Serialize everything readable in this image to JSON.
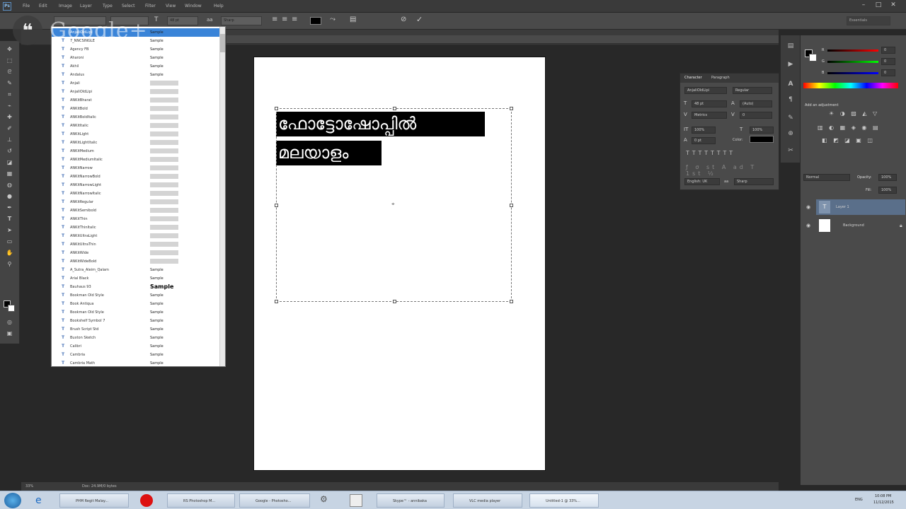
{
  "app": {
    "name": "Ps",
    "menu": [
      "File",
      "Edit",
      "Image",
      "Layer",
      "Type",
      "Select",
      "Filter",
      "View",
      "Window",
      "Help"
    ]
  },
  "options": {
    "font_size": "48 pt",
    "antialias": "Sharp",
    "workspace": "Essentials"
  },
  "font_list": [
    {
      "name": "AnjaliOldLipi",
      "sample": "Sample",
      "selected": true
    },
    {
      "name": "7_NNCSINGLE",
      "sample": "Sample"
    },
    {
      "name": "Agency FB",
      "sample": "Sample"
    },
    {
      "name": "Aharoni",
      "sample": "Sample"
    },
    {
      "name": "Akhil",
      "sample": "Sample"
    },
    {
      "name": "Andalus",
      "sample": "Sample"
    },
    {
      "name": "Anjali",
      "sample": "[boxed]"
    },
    {
      "name": "AnjaliOldLipi",
      "sample": "[boxed]"
    },
    {
      "name": "ANKitBharat",
      "sample": "[boxed]"
    },
    {
      "name": "ANKitBold",
      "sample": "[boxed]"
    },
    {
      "name": "ANKitBoldItalic",
      "sample": "[boxed]"
    },
    {
      "name": "ANKitItalic",
      "sample": "[boxed]"
    },
    {
      "name": "ANKitLight",
      "sample": "[boxed]"
    },
    {
      "name": "ANKitLightItalic",
      "sample": "[boxed]"
    },
    {
      "name": "ANKitMedium",
      "sample": "[boxed]"
    },
    {
      "name": "ANKitMediumItalic",
      "sample": "[boxed]"
    },
    {
      "name": "ANKitNarrow",
      "sample": "[boxed]"
    },
    {
      "name": "ANKitNarrowBold",
      "sample": "[boxed]"
    },
    {
      "name": "ANKitNarrowLight",
      "sample": "[boxed]"
    },
    {
      "name": "ANKitNarrowItalic",
      "sample": "[boxed]"
    },
    {
      "name": "ANKitRegular",
      "sample": "[boxed]"
    },
    {
      "name": "ANKitSemibold",
      "sample": "[boxed]"
    },
    {
      "name": "ANKitThin",
      "sample": "[boxed]"
    },
    {
      "name": "ANKitThinItalic",
      "sample": "[boxed]"
    },
    {
      "name": "ANKitUltraLight",
      "sample": "[boxed]"
    },
    {
      "name": "ANKitUltraThin",
      "sample": "[boxed]"
    },
    {
      "name": "ANKitWide",
      "sample": "[boxed]"
    },
    {
      "name": "ANKitWideBold",
      "sample": "[boxed]"
    },
    {
      "name": "A_Sutra_Aleim_Qalam",
      "sample": "Sample"
    },
    {
      "name": "Arial Black",
      "sample": "Sample"
    },
    {
      "name": "Bauhaus 93",
      "sample": "Sample",
      "bold": true
    },
    {
      "name": "Bookman Old Style",
      "sample": "Sample"
    },
    {
      "name": "Book Antiqua",
      "sample": "Sample"
    },
    {
      "name": "Bookman Old Style",
      "sample": "Sample"
    },
    {
      "name": "Bookshelf Symbol 7",
      "sample": "Sample"
    },
    {
      "name": "Brush Script Std",
      "sample": "Sample"
    },
    {
      "name": "Buxton Sketch",
      "sample": "Sample"
    },
    {
      "name": "Calibri",
      "sample": "Sample"
    },
    {
      "name": "Cambria",
      "sample": "Sample"
    },
    {
      "name": "Cambria Math",
      "sample": "Sample"
    }
  ],
  "canvas": {
    "line1": "ഫോട്ടോഷോപ്പിൽ",
    "line2": "മലയാളം"
  },
  "char_panel": {
    "tabs": [
      "Character",
      "Paragraph"
    ],
    "font": "AnjaliOldLipi",
    "style": "Regular",
    "size": "48 pt",
    "leading": "(Auto)",
    "kerning": "Metrics",
    "tracking": "0",
    "vscale": "100%",
    "hscale": "100%",
    "baseline": "0 pt",
    "color_label": "Color:",
    "language": "English: UK",
    "aa_label": "aa",
    "aa": "Sharp"
  },
  "right_panel": {
    "color_labels": [
      "R",
      "G",
      "B"
    ],
    "color_values": [
      "0",
      "0",
      "0"
    ],
    "adjust_title": "Add an adjustment",
    "blend": "Normal",
    "opacity_label": "Opacity:",
    "opacity": "100%",
    "fill_label": "Fill:",
    "fill": "100%",
    "layers": [
      "Layer 1",
      "Background"
    ]
  },
  "status": {
    "zoom": "33%",
    "doc": "Doc: 24.9M/0 bytes"
  },
  "taskbar": {
    "items": [
      "PHM Regit Malay...",
      "RS Photoshop M...",
      "Google - Photosho...",
      "",
      "",
      "Skype™ - annibaka",
      "VLC media player",
      "Untitled-1 @ 33%..."
    ],
    "time": "10:08 PM",
    "date": "11/12/2015",
    "lang": "ENG"
  },
  "colors": {
    "accent": "#3a84d8",
    "bg": "#282828"
  }
}
